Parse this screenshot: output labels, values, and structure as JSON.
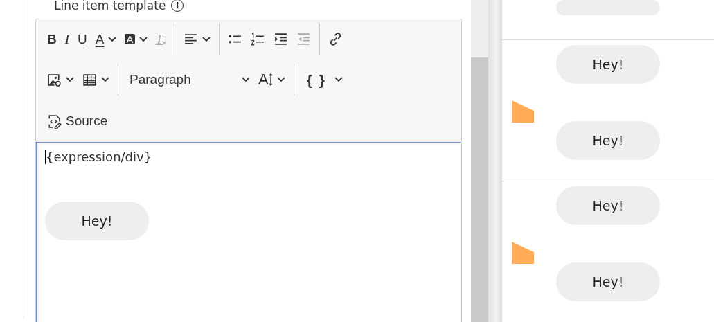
{
  "field": {
    "label": "Line item template",
    "info": "i"
  },
  "toolbar": {
    "rows": [
      [
        {
          "items": [
            {
              "kind": "bold",
              "glyph": "B",
              "disabled": false,
              "has_menu": false
            },
            {
              "kind": "italic",
              "glyph": "I",
              "disabled": false,
              "has_menu": false
            },
            {
              "kind": "underline",
              "glyph": "U",
              "disabled": false,
              "has_menu": false
            },
            {
              "kind": "font-color",
              "glyph": "A",
              "disabled": false,
              "has_menu": true
            },
            {
              "kind": "highlight",
              "glyph": "A",
              "disabled": false,
              "has_menu": true
            },
            {
              "kind": "clear-format",
              "glyph": "T",
              "disabled": true,
              "has_menu": false
            }
          ]
        },
        {
          "items": [
            {
              "kind": "align",
              "disabled": false,
              "has_menu": true
            }
          ]
        },
        {
          "items": [
            {
              "kind": "bullets",
              "disabled": false,
              "has_menu": false
            },
            {
              "kind": "numbers",
              "disabled": false,
              "has_menu": false
            },
            {
              "kind": "indent",
              "disabled": false,
              "has_menu": false
            },
            {
              "kind": "outdent",
              "disabled": true,
              "has_menu": false
            }
          ]
        },
        {
          "items": [
            {
              "kind": "link",
              "disabled": false,
              "has_menu": false
            }
          ]
        }
      ],
      [
        {
          "items": [
            {
              "kind": "image",
              "disabled": false,
              "has_menu": true
            },
            {
              "kind": "table",
              "disabled": false,
              "has_menu": true
            }
          ]
        },
        {
          "items": [
            {
              "kind": "heading",
              "label": "Paragraph",
              "disabled": false,
              "has_menu": true
            },
            {
              "kind": "font-size",
              "glyph": "A",
              "disabled": false,
              "has_menu": true
            }
          ]
        },
        {
          "items": [
            {
              "kind": "braces",
              "glyph": "{ }",
              "disabled": false,
              "has_menu": true
            }
          ]
        }
      ],
      [
        {
          "items": [
            {
              "kind": "source",
              "label": "Source",
              "disabled": false,
              "has_menu": false
            }
          ]
        }
      ]
    ]
  },
  "editor": {
    "text": "{expression/div}",
    "bubble": "Hey!"
  },
  "preview": {
    "sections": [
      {
        "messages": [
          {
            "kind": "bubble"
          }
        ]
      },
      {
        "messages": [
          {
            "kind": "bubble",
            "text": "Hey!"
          },
          {
            "kind": "flag"
          },
          {
            "kind": "bubble",
            "text": "Hey!"
          }
        ]
      },
      {
        "messages": [
          {
            "kind": "bubble",
            "text": "Hey!"
          },
          {
            "kind": "flag"
          },
          {
            "kind": "bubble",
            "text": "Hey!"
          }
        ]
      }
    ]
  }
}
